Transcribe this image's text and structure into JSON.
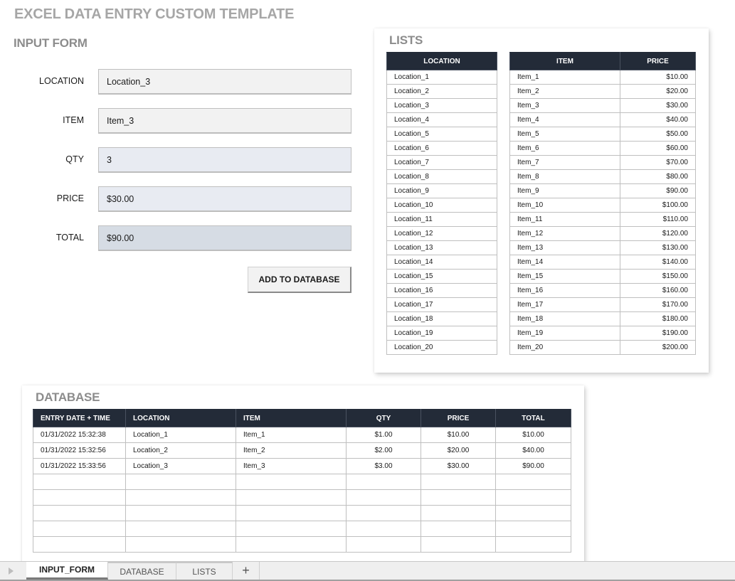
{
  "title": "EXCEL DATA ENTRY CUSTOM TEMPLATE",
  "input_form": {
    "heading": "INPUT FORM",
    "fields": [
      {
        "label": "LOCATION",
        "value": "Location_3"
      },
      {
        "label": "ITEM",
        "value": "Item_3"
      },
      {
        "label": "QTY",
        "value": "3"
      },
      {
        "label": "PRICE",
        "value": "$30.00"
      },
      {
        "label": "TOTAL",
        "value": "$90.00"
      }
    ],
    "button_label": "ADD TO DATABASE"
  },
  "lists": {
    "heading": "LISTS",
    "location_header": "LOCATION",
    "item_header": "ITEM",
    "price_header": "PRICE",
    "locations": [
      "Location_1",
      "Location_2",
      "Location_3",
      "Location_4",
      "Location_5",
      "Location_6",
      "Location_7",
      "Location_8",
      "Location_9",
      "Location_10",
      "Location_11",
      "Location_12",
      "Location_13",
      "Location_14",
      "Location_15",
      "Location_16",
      "Location_17",
      "Location_18",
      "Location_19",
      "Location_20"
    ],
    "items": [
      {
        "item": "Item_1",
        "price": "$10.00"
      },
      {
        "item": "Item_2",
        "price": "$20.00"
      },
      {
        "item": "Item_3",
        "price": "$30.00"
      },
      {
        "item": "Item_4",
        "price": "$40.00"
      },
      {
        "item": "Item_5",
        "price": "$50.00"
      },
      {
        "item": "Item_6",
        "price": "$60.00"
      },
      {
        "item": "Item_7",
        "price": "$70.00"
      },
      {
        "item": "Item_8",
        "price": "$80.00"
      },
      {
        "item": "Item_9",
        "price": "$90.00"
      },
      {
        "item": "Item_10",
        "price": "$100.00"
      },
      {
        "item": "Item_11",
        "price": "$110.00"
      },
      {
        "item": "Item_12",
        "price": "$120.00"
      },
      {
        "item": "Item_13",
        "price": "$130.00"
      },
      {
        "item": "Item_14",
        "price": "$140.00"
      },
      {
        "item": "Item_15",
        "price": "$150.00"
      },
      {
        "item": "Item_16",
        "price": "$160.00"
      },
      {
        "item": "Item_17",
        "price": "$170.00"
      },
      {
        "item": "Item_18",
        "price": "$180.00"
      },
      {
        "item": "Item_19",
        "price": "$190.00"
      },
      {
        "item": "Item_20",
        "price": "$200.00"
      }
    ]
  },
  "database": {
    "heading": "DATABASE",
    "headers": [
      "ENTRY DATE + TIME",
      "LOCATION",
      "ITEM",
      "QTY",
      "PRICE",
      "TOTAL"
    ],
    "rows": [
      [
        "01/31/2022 15:32:38",
        "Location_1",
        "Item_1",
        "$1.00",
        "$10.00",
        "$10.00"
      ],
      [
        "01/31/2022 15:32:56",
        "Location_2",
        "Item_2",
        "$2.00",
        "$20.00",
        "$40.00"
      ],
      [
        "01/31/2022 15:33:56",
        "Location_3",
        "Item_3",
        "$3.00",
        "$30.00",
        "$90.00"
      ],
      [
        "",
        "",
        "",
        "",
        "",
        ""
      ],
      [
        "",
        "",
        "",
        "",
        "",
        ""
      ],
      [
        "",
        "",
        "",
        "",
        "",
        ""
      ],
      [
        "",
        "",
        "",
        "",
        "",
        ""
      ],
      [
        "",
        "",
        "",
        "",
        "",
        ""
      ]
    ]
  },
  "sheet_tabs": {
    "tabs": [
      "INPUT_FORM",
      "DATABASE",
      "LISTS"
    ],
    "active": "INPUT_FORM",
    "add_label": "+"
  }
}
